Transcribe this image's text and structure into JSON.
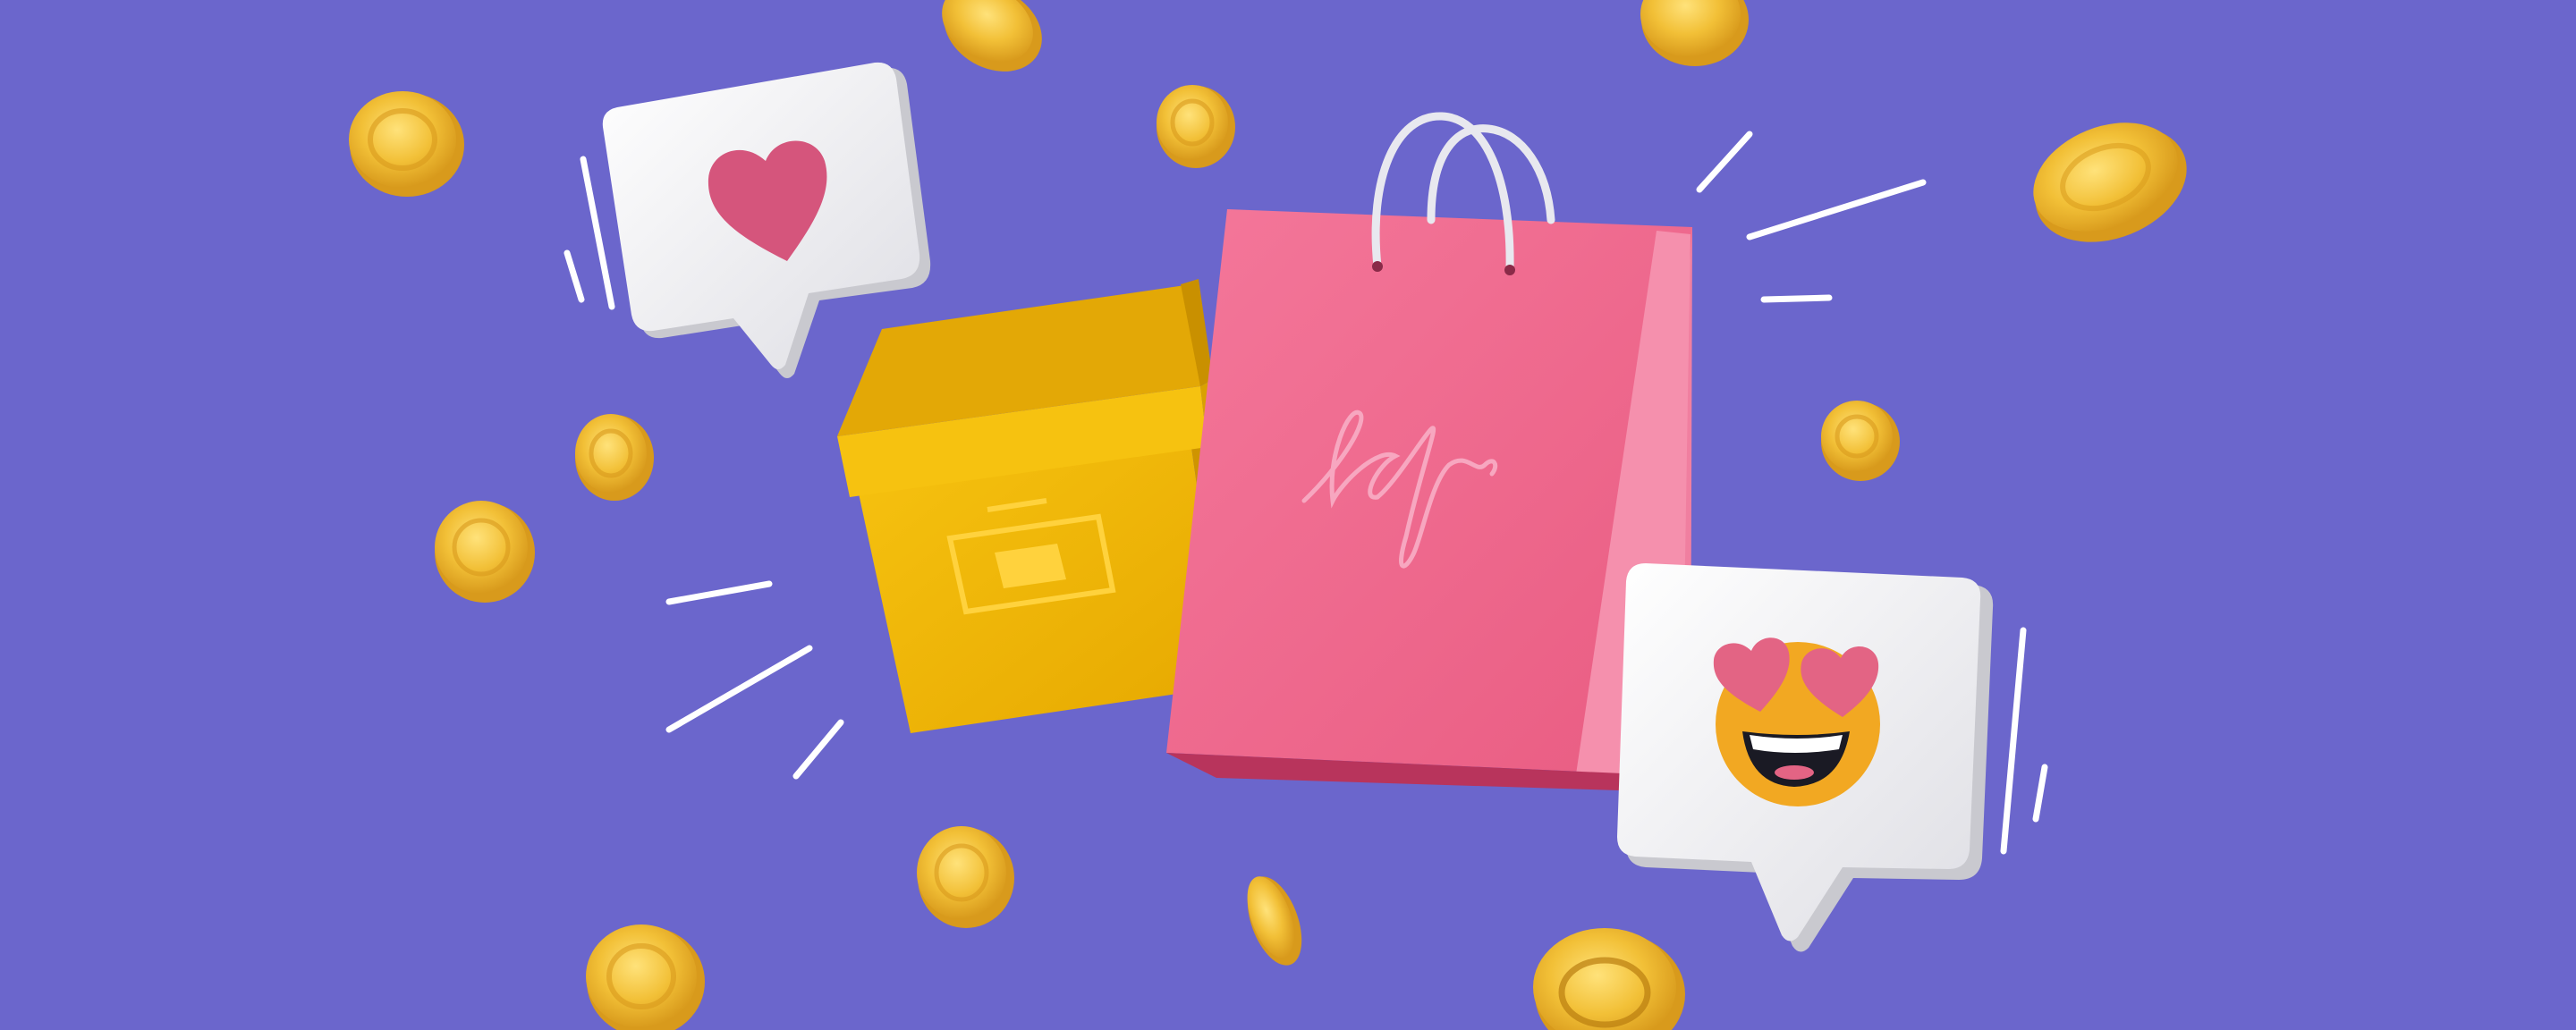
{
  "scene": {
    "background_color": "#6b66cc",
    "elements": [
      "gold-coin",
      "heart-speech-bubble",
      "yellow-gift-box",
      "pink-shopping-bag",
      "emoji-speech-bubble",
      "motion-lines"
    ]
  },
  "colors": {
    "coin_rim": "#d89a1c",
    "coin_face": "#f2c037",
    "coin_highlight": "#ffe27a",
    "box_front": "#f0b600",
    "box_lid": "#f6c210",
    "box_shadow": "#cf9400",
    "bag_front": "#ef6a8c",
    "bag_side": "#f590ad",
    "bag_bottom": "#b8345c",
    "bubble_face": "#ededf0",
    "bubble_edge": "#c9c9cf",
    "heart": "#d5557c",
    "emoji_face": "#f2a822",
    "motion_line": "#ffffff"
  },
  "signature_text": "",
  "icons": {
    "heart": "heart-icon",
    "emoji": "heart-eyes-emoji-icon"
  }
}
